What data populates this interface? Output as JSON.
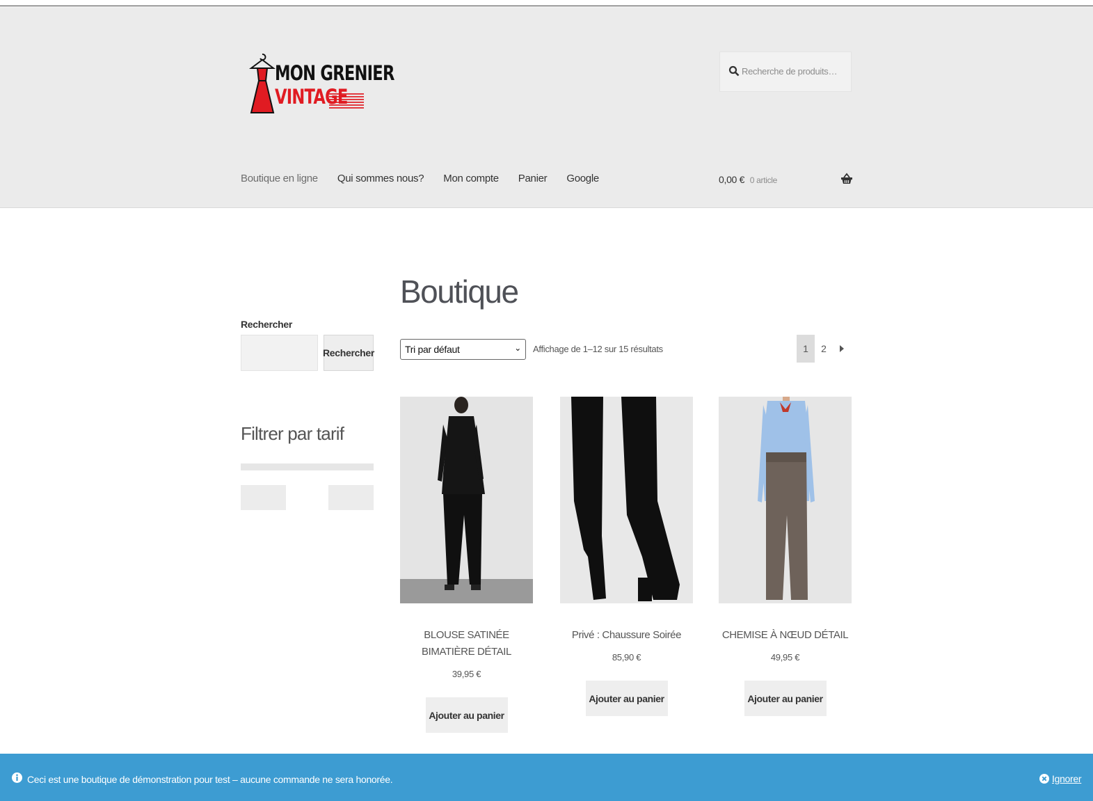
{
  "logo": {
    "line1": "MON GRENIER",
    "line2": "VINTAGE"
  },
  "header": {
    "search_placeholder": "Recherche de produits…",
    "nav": [
      "Boutique en ligne",
      "Qui sommes nous?",
      "Mon compte",
      "Panier",
      "Google"
    ],
    "cart_total": "0,00 €",
    "cart_count": "0 article"
  },
  "sidebar": {
    "search_label": "Rechercher",
    "search_button": "Rechercher",
    "filter_title": "Filtrer par tarif"
  },
  "main": {
    "title": "Boutique",
    "sort_selected": "Tri par défaut",
    "results_text": "Affichage de 1–12 sur 15 résultats",
    "pages": [
      "1",
      "2"
    ],
    "products": [
      {
        "name": "BLOUSE SATINÉE BIMATIÈRE DÉTAIL",
        "price": "39,95 €",
        "button": "Ajouter au panier"
      },
      {
        "name": "Privé : Chaussure Soirée",
        "price": "85,90 €",
        "button": "Ajouter au panier"
      },
      {
        "name": "CHEMISE À NŒUD DÉTAIL",
        "price": "49,95 €",
        "button": "Ajouter au panier"
      }
    ]
  },
  "notice": {
    "message": "Ceci est une boutique de démonstration pour test – aucune commande ne sera honorée.",
    "dismiss": "Ignorer"
  },
  "colors": {
    "accent": "#3d9cd2",
    "header_bg": "#ebebeb",
    "brand_red": "#e01b22"
  }
}
